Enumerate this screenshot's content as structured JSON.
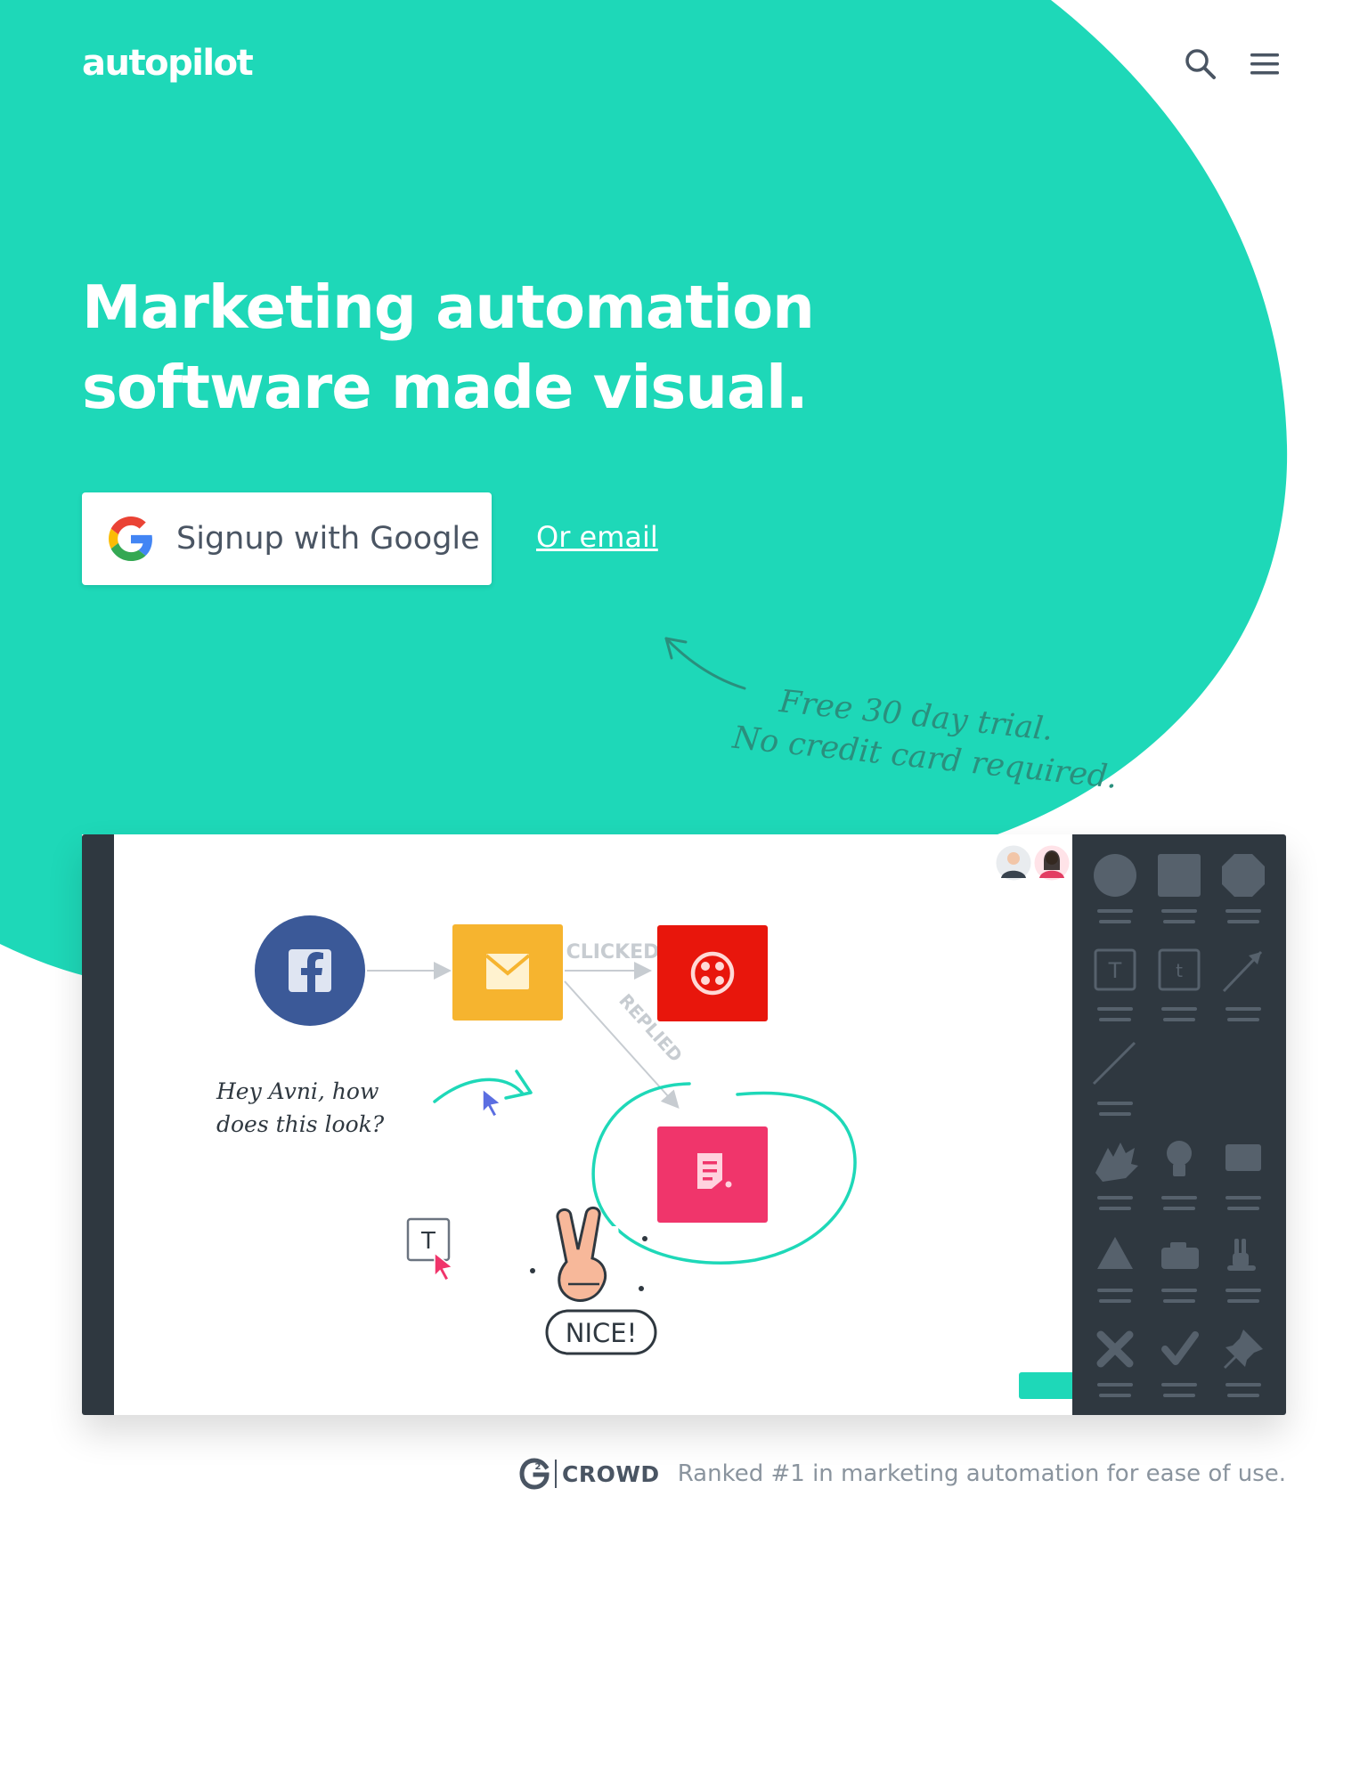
{
  "header": {
    "logo_text": "autopilot",
    "icons": [
      "search-icon",
      "menu-icon"
    ]
  },
  "hero": {
    "headline_line1": "Marketing automation",
    "headline_line2": "software made visual.",
    "google_button_label": "Signup with Google",
    "email_link_label": "Or email",
    "trial_note_line1": "Free 30 day trial.",
    "trial_note_line2": "No credit card required."
  },
  "canvas": {
    "edge_label_clicked": "CLICKED",
    "edge_label_replied": "REPLIED",
    "note_line1": "Hey Avni, how",
    "note_line2": "does this look?",
    "text_tool_letter": "T",
    "sticker_text": "NICE!",
    "nodes": [
      "facebook-icon",
      "email-icon",
      "twilio-icon",
      "form-icon"
    ]
  },
  "shape_panel": {
    "text_shape_letters": [
      "T",
      "t"
    ]
  },
  "ranking": {
    "g2_superscript": "2",
    "g2_wordmark": "CROWD",
    "text": "Ranked #1 in marketing automation for ease of use."
  },
  "colors": {
    "brand_teal": "#1ed8b8",
    "dark_panel": "#2f3840",
    "facebook_blue": "#3b5998",
    "email_yellow": "#f6b42f",
    "twilio_red": "#e8160c",
    "form_pink": "#f0356b"
  }
}
